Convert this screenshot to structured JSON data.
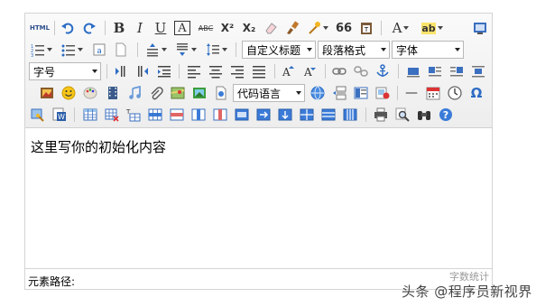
{
  "toolbar": {
    "html_label": "HTML",
    "bold_label": "B",
    "italic_label": "I",
    "underline_label": "U",
    "fontborder_label": "A",
    "strike_label": "ABC",
    "superscript_label": "X²",
    "subscript_label": "X₂",
    "quote_label": "66",
    "forecolor_label": "A",
    "backcolor_label": "ab",
    "custom_style_select": "自定义标题",
    "paragraph_select": "段落格式",
    "font_family_select": "字体",
    "font_size_select": "字号",
    "code_language_select": "代码语言",
    "horizontal_rule_label": "—",
    "special_char_label": "Ω"
  },
  "content": {
    "text": "这里写你的初始化内容"
  },
  "statusbar": {
    "path_label": "元素路径:",
    "word_count_label": "字数统计"
  },
  "watermark": {
    "text": "头条 @程序员新视界"
  },
  "colors": {
    "toolbar_bg": "#f0f0f0",
    "border": "#d4d4d4",
    "icon_blue": "#2b6cc4",
    "help_blue": "#3b7bd8"
  }
}
